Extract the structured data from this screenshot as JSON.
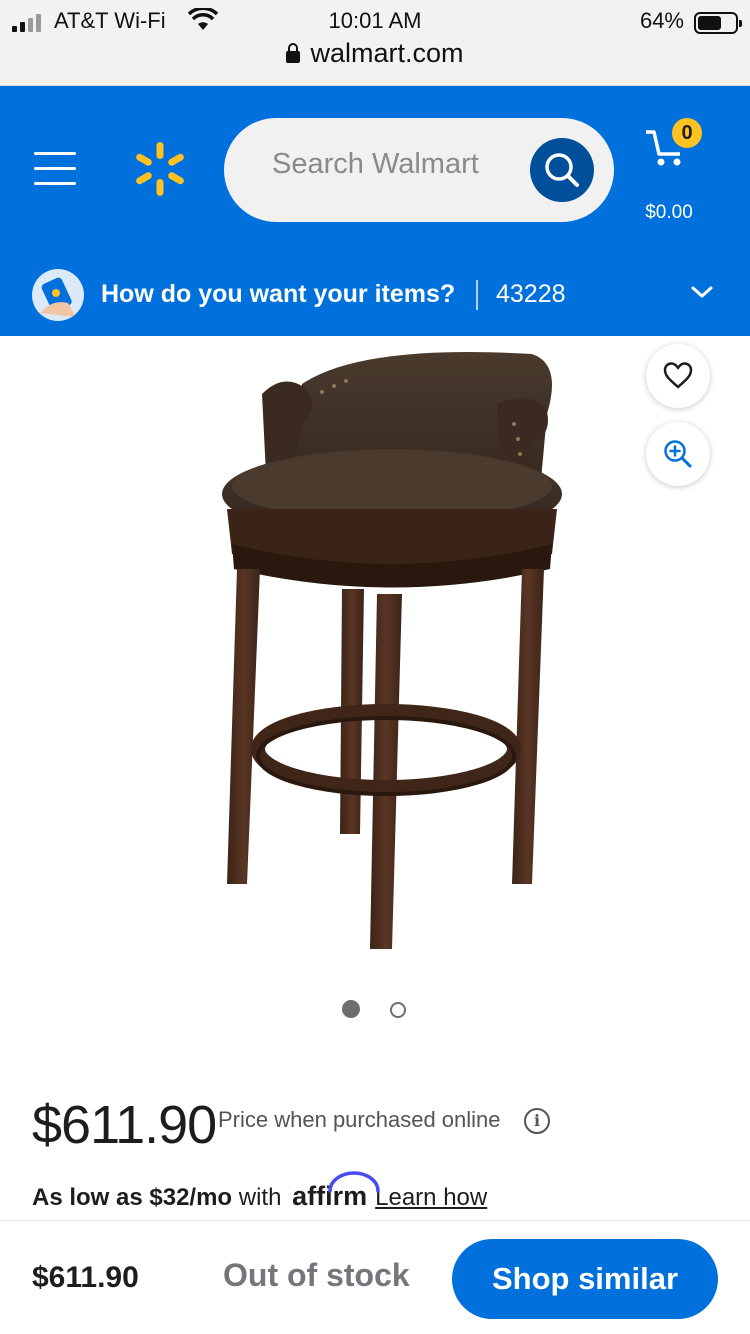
{
  "status_bar": {
    "carrier": "AT&T Wi-Fi",
    "time": "10:01 AM",
    "battery": "64%",
    "battery_level": 0.64,
    "url": "walmart.com"
  },
  "header": {
    "search_placeholder": "Search Walmart",
    "cart_count": "0",
    "cart_total": "$0.00",
    "delivery_question": "How do you want your items?",
    "zip_code": "43228"
  },
  "gallery": {
    "image_count": 2,
    "active_index": 0
  },
  "product": {
    "price": "$611.90",
    "price_note": "Price when purchased online",
    "info_symbol": "i",
    "affirm_prefix": "As low as $32/mo",
    "affirm_with": "with",
    "affirm_brand": "affirm",
    "affirm_link": "Learn how"
  },
  "bottom_bar": {
    "price": "$611.90",
    "stock_status": "Out of stock",
    "button_label": "Shop similar"
  },
  "colors": {
    "brand_blue": "#0071dc",
    "spark_yellow": "#ffc220",
    "search_button": "#004f9a"
  }
}
